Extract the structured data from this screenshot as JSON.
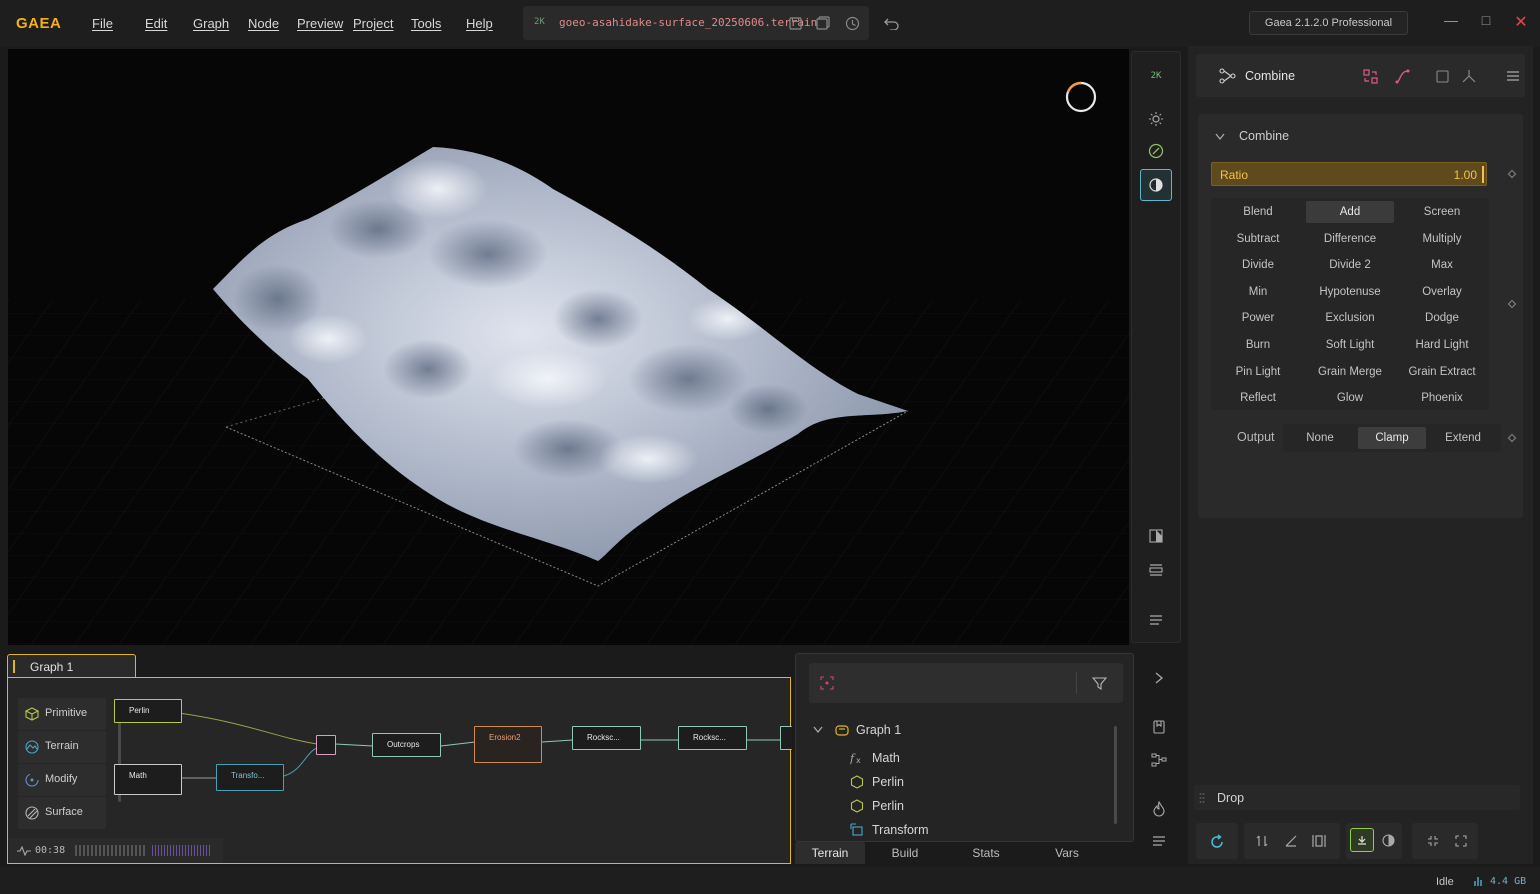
{
  "app": {
    "logo": "GAEA",
    "menu": [
      "File",
      "Edit",
      "Graph",
      "Node",
      "Preview",
      "Project",
      "Tools",
      "Help"
    ],
    "file_badge": "2K",
    "file_name": "goeo-asahidake-surface_20250606.terrain",
    "version": "Gaea 2.1.2.0 Professional"
  },
  "viewport": {
    "resolution_badge": "2K"
  },
  "properties": {
    "node_title": "Combine",
    "section_title": "Combine",
    "ratio_label": "Ratio",
    "ratio_value": "1.00",
    "blend_modes": [
      "Blend",
      "Add",
      "Screen",
      "Subtract",
      "Difference",
      "Multiply",
      "Divide",
      "Divide 2",
      "Max",
      "Min",
      "Hypotenuse",
      "Overlay",
      "Power",
      "Exclusion",
      "Dodge",
      "Burn",
      "Soft Light",
      "Hard Light",
      "Pin Light",
      "Grain Merge",
      "Grain Extract",
      "Reflect",
      "Glow",
      "Phoenix"
    ],
    "selected_blend": "Add",
    "output_label": "Output",
    "output_options": [
      "None",
      "Clamp",
      "Extend"
    ],
    "selected_output": "Clamp",
    "drop_label": "Drop"
  },
  "graph": {
    "tab_label": "Graph 1",
    "palette": [
      "Primitive",
      "Terrain",
      "Modify",
      "Surface"
    ],
    "nodes": [
      {
        "label": "Perlin",
        "color": "#b9c74a"
      },
      {
        "label": "Math",
        "color": "#c9c9c9"
      },
      {
        "label": "Transfo...",
        "color": "#4a9fb0"
      },
      {
        "label": "",
        "color": "#d6a0c0"
      },
      {
        "label": "Outcrops",
        "color": "#8fc9b5"
      },
      {
        "label": "Erosion2",
        "color": "#d08a4a"
      },
      {
        "label": "Rocksc...",
        "color": "#8fc9b5"
      },
      {
        "label": "Rocksc...",
        "color": "#8fc9b5"
      }
    ],
    "timer": "00:38"
  },
  "explorer": {
    "root": "Graph 1",
    "items": [
      {
        "label": "Math",
        "icon": "fx-icon"
      },
      {
        "label": "Perlin",
        "icon": "hexagon-icon"
      },
      {
        "label": "Perlin",
        "icon": "hexagon-icon"
      },
      {
        "label": "Transform",
        "icon": "transform-icon"
      }
    ],
    "tabs": [
      "Terrain",
      "Build",
      "Stats",
      "Vars"
    ],
    "selected_tab": "Terrain"
  },
  "status": {
    "state": "Idle",
    "memory": "4.4 GB"
  }
}
